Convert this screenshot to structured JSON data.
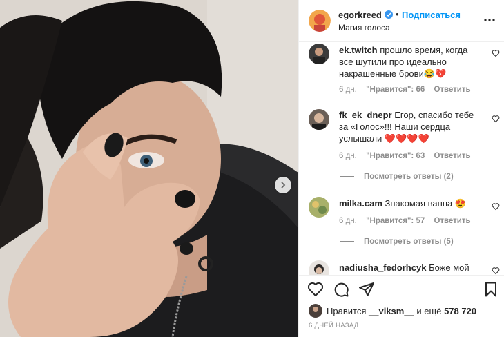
{
  "post": {
    "photo_icon": "person-photo",
    "next_icon": "chevron-right-icon"
  },
  "header": {
    "username": "egorkreed",
    "dot": "•",
    "follow_label": "Подписаться",
    "subtitle": "Магия голоса",
    "more_icon": "more-horizontal-icon"
  },
  "comments": [
    {
      "username": "ek.twitch",
      "text": "прошло время, когда все шутили про идеально накрашенные брови😂💔",
      "age": "6 дн.",
      "likes": "\"Нравится\": 66",
      "reply": "Ответить"
    },
    {
      "username": "fk_ek_dnepr",
      "text": "Егор, спасибо тебе за «Голос»!!! Наши сердца услышали ❤️❤️❤️❤️",
      "age": "6 дн.",
      "likes": "\"Нравится\": 63",
      "reply": "Ответить",
      "view_replies": "Посмотреть ответы (2)"
    },
    {
      "username": "milka.cam",
      "text": "Знакомая ванна 😍",
      "age": "6 дн.",
      "likes": "\"Нравится\": 57",
      "reply": "Ответить",
      "view_replies": "Посмотреть ответы (5)"
    },
    {
      "username": "nadiusha_fedorhcyk",
      "text": "Боже мой"
    }
  ],
  "actions": {
    "like_icon": "heart-icon",
    "comment_icon": "comment-icon",
    "share_icon": "send-icon",
    "save_icon": "bookmark-icon"
  },
  "likes": {
    "prefix": "Нравится",
    "user": "__viksm__",
    "middle": "и ещё",
    "count": "578 720"
  },
  "date": "6 ДНЕЙ НАЗАД",
  "colors": {
    "accent": "#0095f6",
    "muted": "#8e8e8e",
    "text": "#262626",
    "border": "#efefef"
  }
}
